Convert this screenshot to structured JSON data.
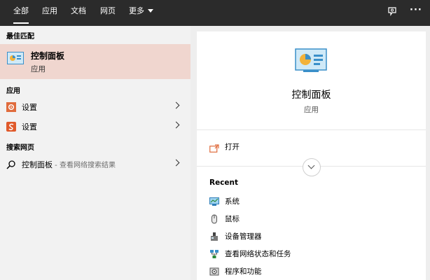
{
  "tabs": [
    {
      "label": "全部",
      "active": true
    },
    {
      "label": "应用"
    },
    {
      "label": "文档"
    },
    {
      "label": "网页"
    },
    {
      "label": "更多"
    }
  ],
  "top_icons": [
    "feedback-icon",
    "more-icon"
  ],
  "top_icons_text": {
    "more": "···"
  },
  "left": {
    "best_match": {
      "heading": "最佳匹配",
      "title": "控制面板",
      "subtitle": "应用",
      "icon": "control-panel-icon"
    },
    "apps": {
      "heading": "应用",
      "items": [
        {
          "label": "设置",
          "icon": "settings-gear-icon"
        },
        {
          "label": "设置",
          "icon": "settings-s-icon"
        }
      ]
    },
    "web": {
      "heading": "搜索网页",
      "query": "控制面板",
      "suffix": " - 查看网络搜索结果",
      "icon": "search-icon"
    }
  },
  "right": {
    "title": "控制面板",
    "subtitle": "应用",
    "open_label": "打开",
    "recent_heading": "Recent",
    "recent": [
      {
        "label": "系统",
        "icon": "system-icon"
      },
      {
        "label": "鼠标",
        "icon": "mouse-icon"
      },
      {
        "label": "设备管理器",
        "icon": "device-manager-icon"
      },
      {
        "label": "查看网络状态和任务",
        "icon": "network-icon"
      },
      {
        "label": "程序和功能",
        "icon": "programs-icon"
      }
    ]
  },
  "colors": {
    "topbar": "#2b2b2b",
    "selected": "#f0d6cf",
    "accent": "#e06c3d"
  }
}
